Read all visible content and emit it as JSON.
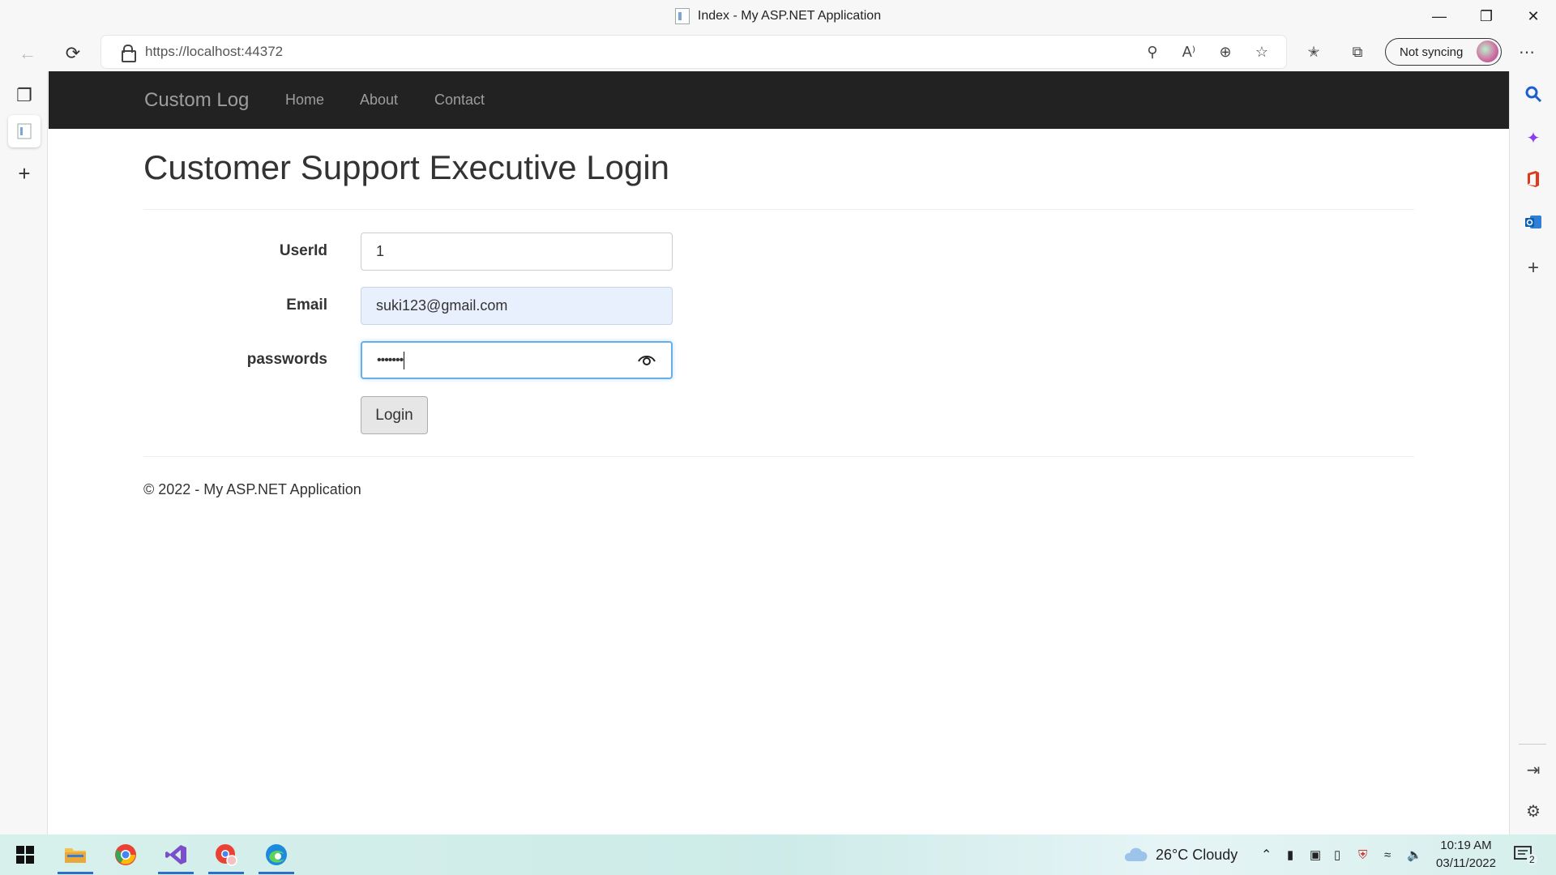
{
  "window": {
    "title": "Index - My ASP.NET Application"
  },
  "browser": {
    "url": "https://localhost:44372",
    "sync_label": "Not syncing"
  },
  "site": {
    "brand": "Custom Log",
    "nav": [
      "Home",
      "About",
      "Contact"
    ],
    "heading": "Customer Support Executive Login",
    "form": {
      "userid_label": "UserId",
      "userid_value": "1",
      "email_label": "Email",
      "email_value": "suki123@gmail.com",
      "password_label": "passwords",
      "password_value": "•••••••",
      "login_label": "Login"
    },
    "footer": "© 2022 - My ASP.NET Application"
  },
  "taskbar": {
    "weather": "26°C  Cloudy",
    "time": "10:19 AM",
    "date": "03/11/2022",
    "notification_count": "2"
  },
  "colors": {
    "navbar": "#222222",
    "nav_text": "#9d9d9d",
    "focus": "#66afe9",
    "autofill": "#e8f0fe"
  }
}
